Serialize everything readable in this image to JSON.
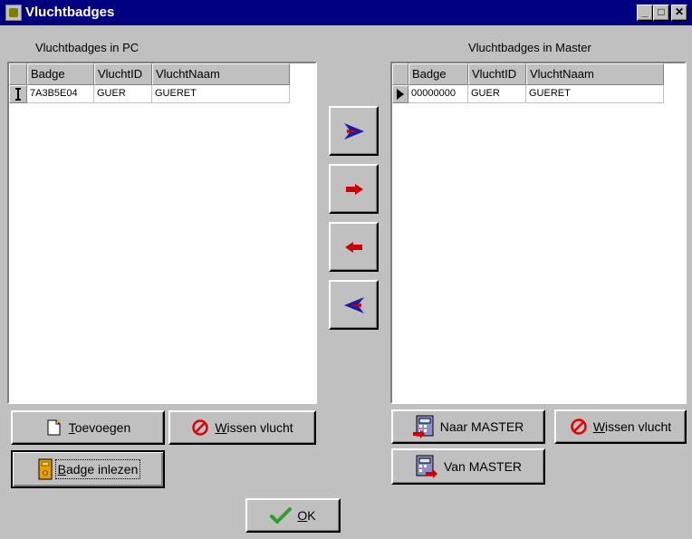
{
  "window": {
    "title": "Vluchtbadges",
    "minimize_glyph": "_",
    "maximize_glyph": "□",
    "close_glyph": "✕"
  },
  "left_panel": {
    "label": "Vluchtbadges in PC",
    "columns": [
      "Badge",
      "VluchtID",
      "VluchtNaam"
    ],
    "rows": [
      {
        "badge": "7A3B5E04",
        "vluchtid": "GUER",
        "vluchtnaam": "GUERET",
        "indicator": "edit-cursor-icon"
      }
    ]
  },
  "right_panel": {
    "label": "Vluchtbadges in Master",
    "columns": [
      "Badge",
      "VluchtID",
      "VluchtNaam"
    ],
    "rows": [
      {
        "badge": "00000000",
        "vluchtid": "GUER",
        "vluchtnaam": "GUERET",
        "indicator": "current-row-pointer-icon"
      }
    ]
  },
  "transfer_buttons": [
    {
      "name": "transfer-all-right-button",
      "icon": "blue-arrow-right-icon"
    },
    {
      "name": "transfer-right-button",
      "icon": "red-arrow-right-icon"
    },
    {
      "name": "transfer-left-button",
      "icon": "red-arrow-left-icon"
    },
    {
      "name": "transfer-all-left-button",
      "icon": "blue-arrow-left-icon"
    }
  ],
  "buttons": {
    "toevoegen": {
      "accel": "T",
      "rest": "oevoegen"
    },
    "wissen_left": {
      "accel": "W",
      "rest": "issen vlucht"
    },
    "badge_inlezen": {
      "accel": "B",
      "rest": "adge inlezen"
    },
    "naar_master": {
      "label": "Naar MASTER"
    },
    "van_master": {
      "label": "Van MASTER"
    },
    "wissen_right": {
      "accel": "W",
      "rest": "issen vlucht"
    },
    "ok": {
      "accel": "O",
      "rest": "K"
    }
  },
  "colors": {
    "titlebar": "#000080",
    "face": "#c0c0c0",
    "arrow_blue": "#1a1aa8",
    "arrow_red": "#cc0000",
    "check_green": "#2e9e2e"
  }
}
